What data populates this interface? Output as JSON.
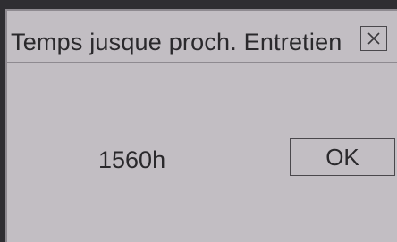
{
  "dialog": {
    "title": "Temps jusque proch. Entretien",
    "close_icon": "close-icon",
    "value": "1560h",
    "ok_label": "OK"
  },
  "colors": {
    "dialog_background": "#c2bec3",
    "outer_background": "#2f2e32",
    "text": "#2a292c",
    "border": "#4a484c",
    "divider": "#8e8a90"
  }
}
